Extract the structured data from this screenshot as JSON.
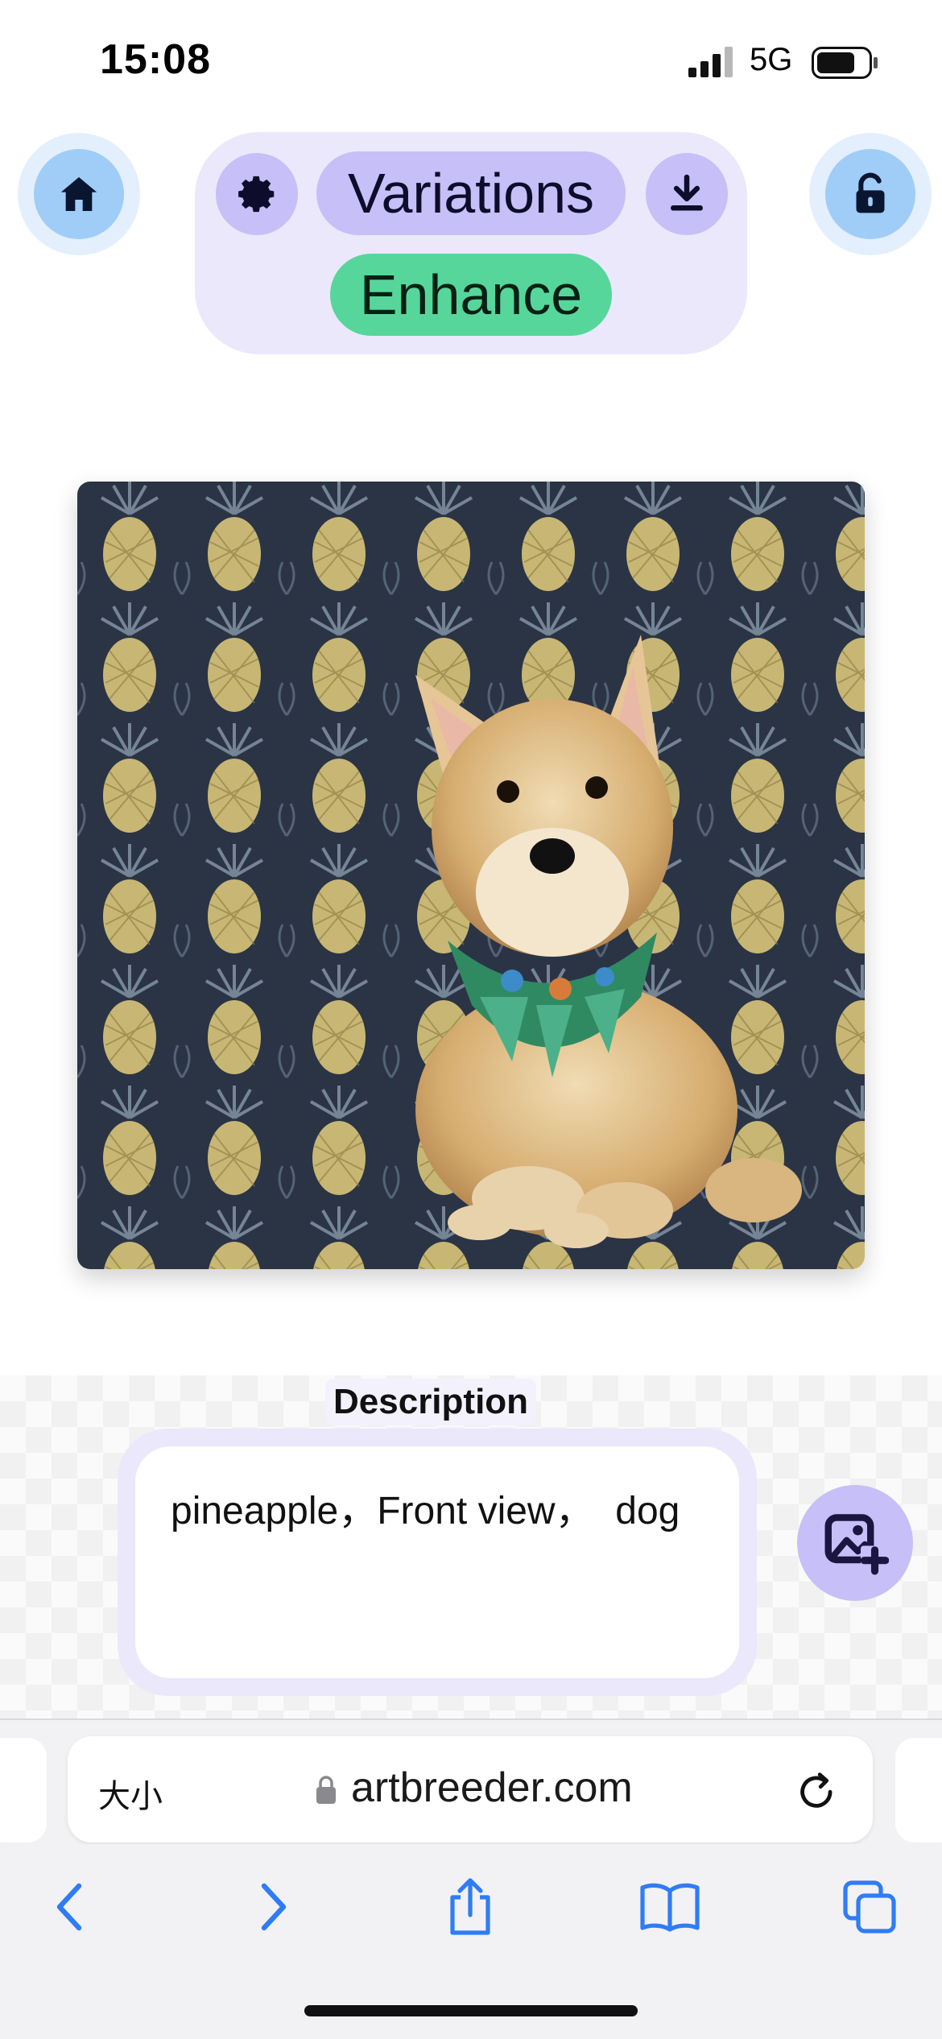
{
  "status_bar": {
    "time": "15:08",
    "network": "5G"
  },
  "toolbar": {
    "variations_label": "Variations",
    "enhance_label": "Enhance"
  },
  "artwork": {
    "subject": "dog on pineapple pattern background"
  },
  "description": {
    "label": "Description",
    "text": "pineapple，Front view，  dog"
  },
  "browser": {
    "text_size_label": "大小",
    "url": "artbreeder.com"
  },
  "colors": {
    "panel": "#ebe8fb",
    "pill": "#c7bff7",
    "enhance": "#56d69b",
    "nav_circle": "#9fcdf8",
    "ios_blue": "#2f7cf6"
  },
  "icons": {
    "home": "home-icon",
    "settings": "gear-icon",
    "download": "download-icon",
    "lock": "lock-open-icon",
    "add_image": "add-image-icon",
    "back": "chevron-left-icon",
    "forward": "chevron-right-icon",
    "share": "share-icon",
    "bookmarks": "book-icon",
    "tabs": "tabs-icon"
  }
}
